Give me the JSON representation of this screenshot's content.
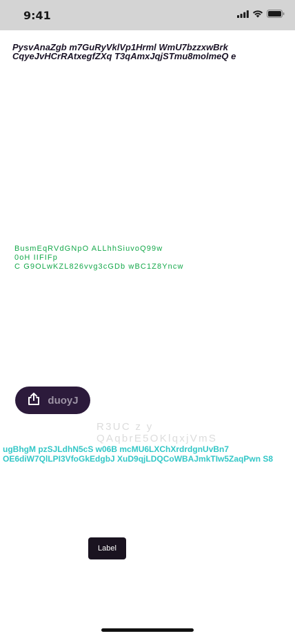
{
  "status_bar": {
    "time": "9:41",
    "icons": [
      "signal-icon",
      "wifi-icon",
      "battery-icon"
    ]
  },
  "header": {
    "text": "PysvAnaZgb m7GuRyVklVp1Hrml WmU7bzzxwBrk CqyeJvHCrRAtxegfZXq T3qAmxJqjSTmu8molmeQ e"
  },
  "green_block": {
    "lines": [
      "BusmEqRVdGNpO ALLhhSiuvoQ99w",
      "0oH IIFIFp",
      "C G9OLwKZL826vvg3cGDb wBC1Z8Yncw"
    ]
  },
  "share_button": {
    "label": "duoyJ",
    "icon": "share-icon"
  },
  "faint_block": {
    "lines": [
      "R3UC z y",
      "QAqbrE5OKlqxjVmS"
    ]
  },
  "teal_block": {
    "text": "ugBhgM pzSJLdhN5cS w06B mcMU6LXChXrdrdgnUvBn7 OE6diW7QlLPI3VfoGkEdgbJ XuD9qjLDQCoWBAJmkTIw5ZaqPwn S8"
  },
  "small_button": {
    "label": "Label"
  },
  "colors": {
    "status_bar_bg": "#d4d4d4",
    "header_text": "#1a1326",
    "green_text": "#14a84a",
    "share_button_bg": "#2c1a3b",
    "teal_text": "#33c7c7",
    "label_bg": "#1a1320"
  }
}
